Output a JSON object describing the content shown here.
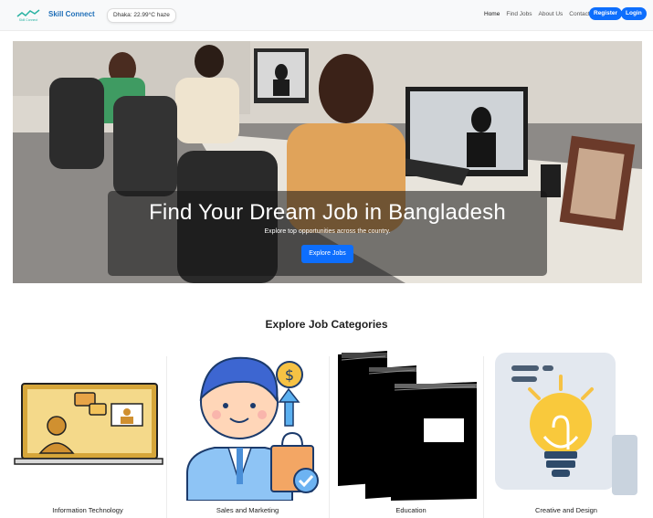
{
  "brand": {
    "name": "Skill Connect",
    "logo_text": "Skill Connect"
  },
  "weather": {
    "text": "Dhaka: 22.99°C haze"
  },
  "nav": {
    "links": [
      "Home",
      "Find Jobs",
      "About Us",
      "Contact"
    ],
    "register_label": "Register",
    "login_label": "Login"
  },
  "hero": {
    "title": "Find Your Dream Job in Bangladesh",
    "subtitle": "Explore top opportunities across the country.",
    "button_label": "Explore Jobs"
  },
  "categories": {
    "title": "Explore Job Categories",
    "items": [
      {
        "label": "Information Technology",
        "icon": "online-meeting-icon"
      },
      {
        "label": "Sales and Marketing",
        "icon": "salesperson-icon"
      },
      {
        "label": "Education",
        "icon": "books-icon"
      },
      {
        "label": "Creative and Design",
        "icon": "lightbulb-icon"
      }
    ]
  },
  "colors": {
    "primary": "#0d6efd",
    "brand": "#1f6fb8",
    "navbar_bg": "#f8f9fa"
  }
}
